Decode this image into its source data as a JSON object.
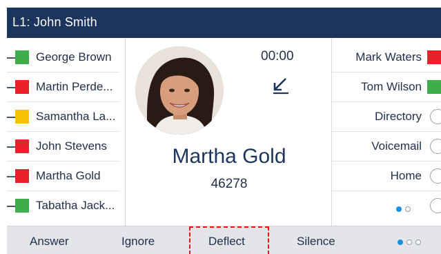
{
  "title": "L1: John Smith",
  "left_keys": [
    {
      "label": "George Brown",
      "status": "green"
    },
    {
      "label": "Martin Perde...",
      "status": "red"
    },
    {
      "label": "Samantha La...",
      "status": "yellow"
    },
    {
      "label": "John Stevens",
      "status": "red"
    },
    {
      "label": "Martha Gold",
      "status": "red"
    },
    {
      "label": "Tabatha Jack...",
      "status": "green"
    }
  ],
  "right_keys": [
    {
      "label": "Mark Waters",
      "status": "red"
    },
    {
      "label": "Tom Wilson",
      "status": "green"
    },
    {
      "label": "Directory",
      "status": "empty"
    },
    {
      "label": "Voicemail",
      "status": "empty"
    },
    {
      "label": "Home",
      "status": "empty"
    },
    {
      "label": "",
      "status": "empty"
    }
  ],
  "call": {
    "timer": "00:00",
    "direction_icon": "incoming-call-arrow-icon",
    "caller_name": "Martha Gold",
    "caller_number": "46278"
  },
  "softkeys": {
    "answer": "Answer",
    "ignore": "Ignore",
    "deflect": "Deflect",
    "silence": "Silence"
  },
  "colors": {
    "title_bar": "#1b355c",
    "green": "#3eae4a",
    "red": "#e8212b",
    "yellow": "#f6c400",
    "highlight": "#e3141c",
    "page_dot_active": "#1e8fe0"
  }
}
